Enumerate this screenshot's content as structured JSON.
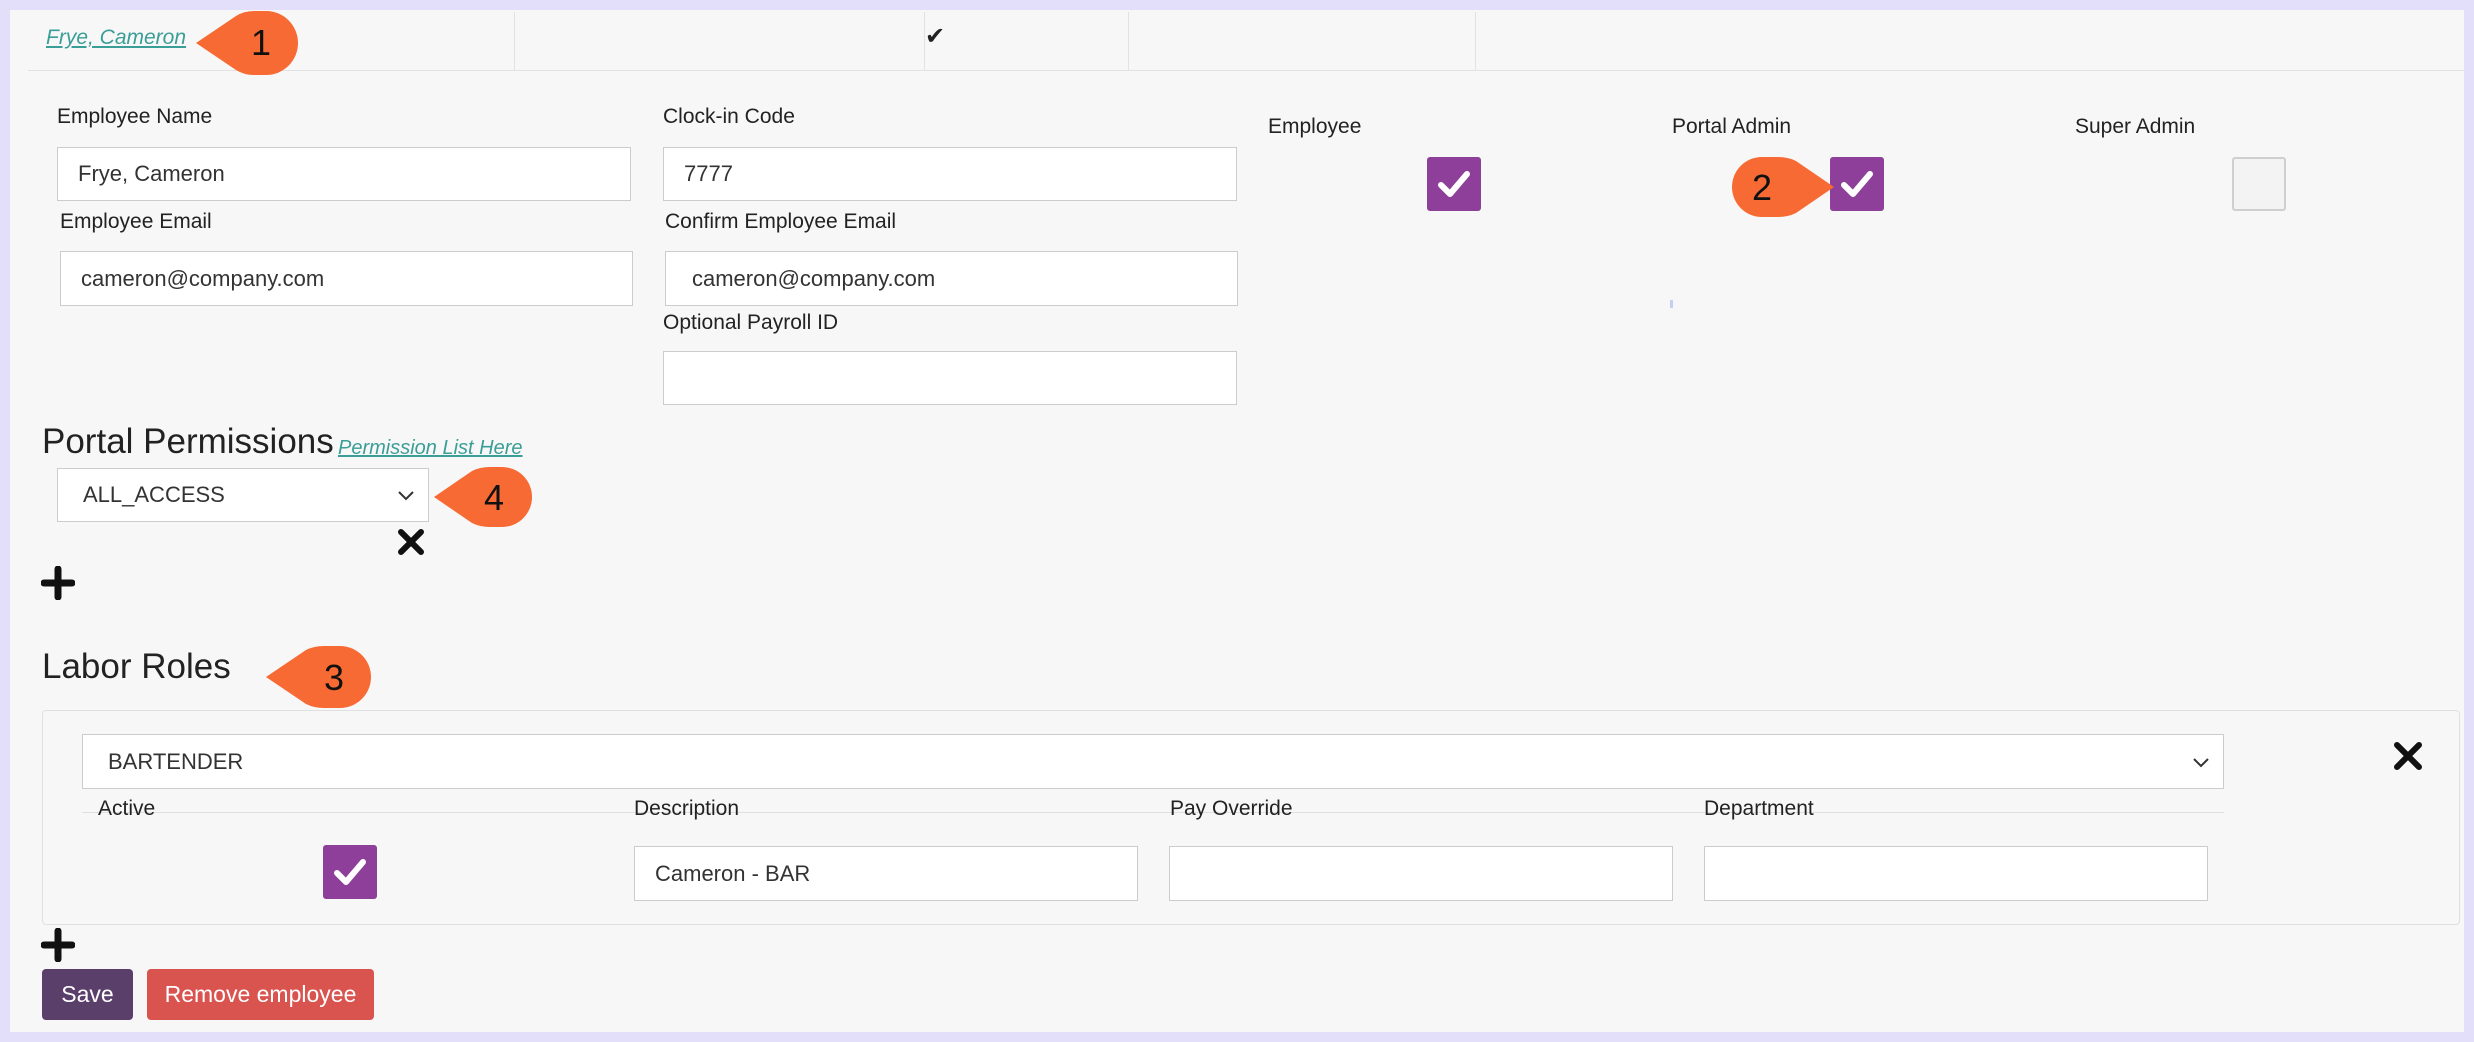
{
  "employee_row": {
    "name_link": "Frye, Cameron",
    "check_glyph": "✔"
  },
  "form": {
    "employee_name_label": "Employee Name",
    "employee_name_value": "Frye, Cameron",
    "clockin_label": "Clock-in Code",
    "clockin_value": "7777",
    "email_label": "Employee Email",
    "email_value": "cameron@company.com",
    "confirm_email_label": "Confirm Employee Email",
    "confirm_email_value": "cameron@company.com",
    "payroll_label": "Optional Payroll ID",
    "payroll_value": ""
  },
  "roles_flags": {
    "employee_label": "Employee",
    "employee_checked": true,
    "portal_admin_label": "Portal Admin",
    "portal_admin_checked": true,
    "super_admin_label": "Super Admin",
    "super_admin_checked": false
  },
  "portal_permissions": {
    "heading": "Portal Permissions",
    "list_link": "Permission List Here",
    "selected": "ALL_ACCESS"
  },
  "labor_roles": {
    "heading": "Labor Roles",
    "role_selected": "BARTENDER",
    "col_active": "Active",
    "col_description": "Description",
    "col_pay_override": "Pay Override",
    "col_department": "Department",
    "active_checked": true,
    "description_value": "Cameron - BAR",
    "pay_override_value": "",
    "department_value": ""
  },
  "actions": {
    "save_label": "Save",
    "remove_label": "Remove employee"
  },
  "callouts": [
    "1",
    "2",
    "3",
    "4"
  ],
  "colors": {
    "accent_purple": "#8e3f9a",
    "link_teal": "#3a9e98",
    "save_bg": "#5b3f6b",
    "remove_bg": "#d9534f",
    "callout_orange": "#f76a33",
    "frame_lavender": "#e3defa"
  }
}
